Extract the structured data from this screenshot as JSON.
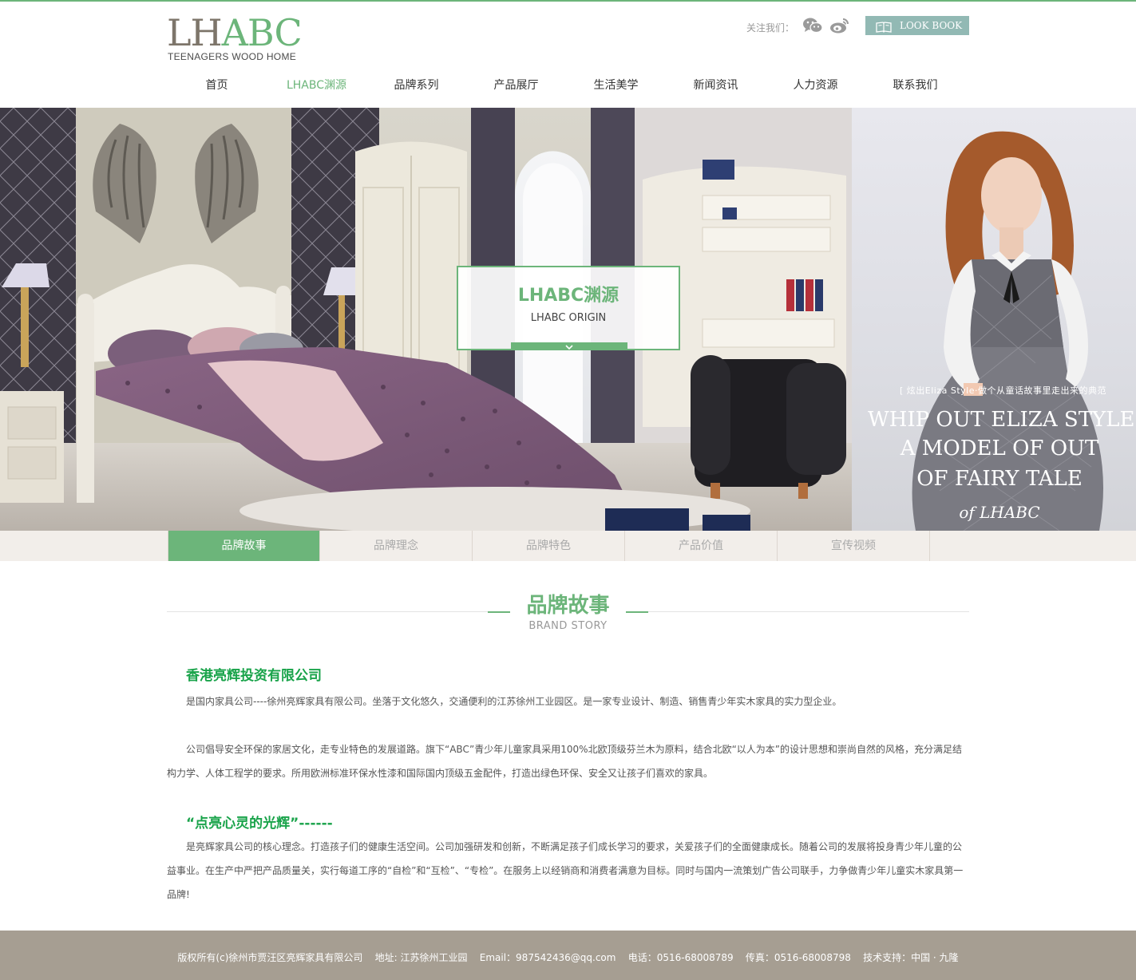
{
  "brand": {
    "logo_main_1": "LH",
    "logo_main_2": "ABC",
    "logo_sub": "TEENAGERS WOOD HOME"
  },
  "header": {
    "follow_label": "关注我们：",
    "lookbook_label": "LOOK BOOK"
  },
  "nav": {
    "items": [
      "首页",
      "LHABC渊源",
      "品牌系列",
      "产品展厅",
      "生活美学",
      "新闻资讯",
      "人力资源",
      "联系我们"
    ],
    "active_index": 1
  },
  "banner": {
    "title": "LHABC渊源",
    "subtitle": "LHABC ORIGIN",
    "side_cn": "[ 炫出Eliza Style·做个从童话故事里走出来的典范",
    "side_en_1": "WHIP OUT ELIZA STYLE M",
    "side_en_2": "A MODEL OF OUT",
    "side_en_3": "OF FAIRY TALE",
    "side_en_4": "of LHABC"
  },
  "tabs": {
    "items": [
      "品牌故事",
      "品牌理念",
      "品牌特色",
      "产品价值",
      "宣传视频"
    ],
    "active_index": 0
  },
  "section": {
    "title": "品牌故事",
    "subtitle": "BRAND STORY"
  },
  "content": {
    "company_heading": "香港亮辉投资有限公司",
    "para1": "是国内家具公司----徐州亮辉家具有限公司。坐落于文化悠久，交通便利的江苏徐州工业园区。是一家专业设计、制造、销售青少年实木家具的实力型企业。",
    "para2": "公司倡导安全环保的家居文化，走专业特色的发展道路。旗下“ABC”青少年儿童家具采用100%北欧顶级芬兰木为原料，结合北欧“以人为本”的设计思想和崇尚自然的风格，充分满足结构力学、人体工程学的要求。所用欧洲标准环保水性漆和国际国内顶级五金配件，打造出绿色环保、安全又让孩子们喜欢的家具。",
    "slogan_heading": "“点亮心灵的光辉”------",
    "para3": "是亮辉家具公司的核心理念。打造孩子们的健康生活空间。公司加强研发和创新，不断满足孩子们成长学习的要求，关爱孩子们的全面健康成长。随着公司的发展将投身青少年儿童的公益事业。在生产中严把产品质量关，实行每道工序的“自检”和“互检”、“专检”。在服务上以经销商和消费者满意为目标。同时与国内一流策划广告公司联手，力争做青少年儿童实木家具第一品牌!"
  },
  "footer": {
    "text": "版权所有(c)徐州市贾汪区亮辉家具有限公司    地址: 江苏徐州工业园    Email：987542436@qq.com    电话：0516-68008789    传真：0516-68008798    技术支持：中国 · 九隆"
  },
  "colors": {
    "accent_green": "#6cb57a",
    "heading_green": "#19a34a",
    "lookbook_bg": "#92b9b4",
    "footer_bg": "#a69e92",
    "tabbar_bg": "#f2eeea"
  },
  "icons": [
    "wechat-icon",
    "weibo-icon",
    "book-icon",
    "chevron-down-icon"
  ]
}
